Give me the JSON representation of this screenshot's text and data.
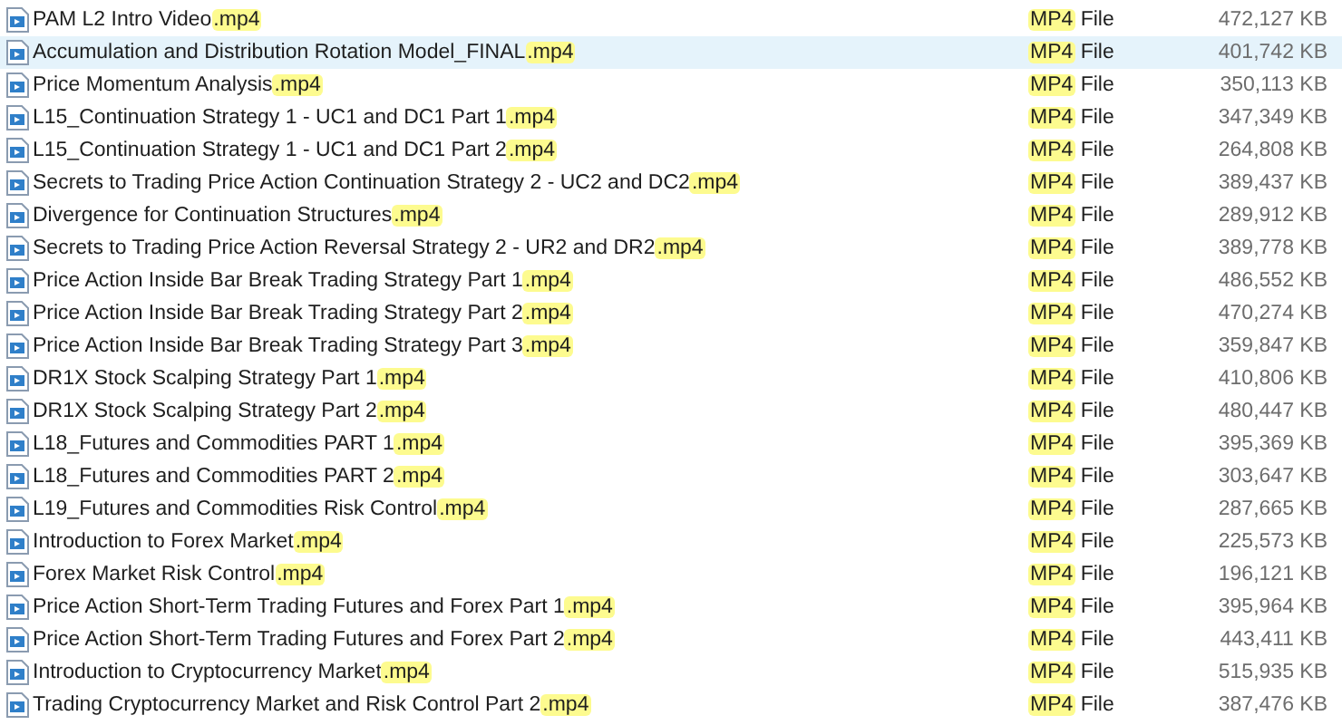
{
  "files": [
    {
      "name": [
        {
          "text": "PAM L2 Intro Video",
          "highlighted": false
        },
        {
          "text": ".mp4",
          "highlighted": true
        }
      ],
      "type": [
        {
          "text": "MP4",
          "highlighted": true
        },
        {
          "text": " File",
          "highlighted": false
        }
      ],
      "size": "472,127 KB",
      "selected": false
    },
    {
      "name": [
        {
          "text": "Accumulation and Distribution Rotation Model_FINAL",
          "highlighted": false
        },
        {
          "text": ".mp4",
          "highlighted": true
        }
      ],
      "type": [
        {
          "text": "MP4",
          "highlighted": true
        },
        {
          "text": " File",
          "highlighted": false
        }
      ],
      "size": "401,742 KB",
      "selected": true
    },
    {
      "name": [
        {
          "text": "Price Momentum Analysis",
          "highlighted": false
        },
        {
          "text": ".mp4",
          "highlighted": true
        }
      ],
      "type": [
        {
          "text": "MP4",
          "highlighted": true
        },
        {
          "text": " File",
          "highlighted": false
        }
      ],
      "size": "350,113 KB",
      "selected": false
    },
    {
      "name": [
        {
          "text": "L15_Continuation Strategy 1 - UC1 and DC1 Part 1",
          "highlighted": false
        },
        {
          "text": ".mp4",
          "highlighted": true
        }
      ],
      "type": [
        {
          "text": "MP4",
          "highlighted": true
        },
        {
          "text": " File",
          "highlighted": false
        }
      ],
      "size": "347,349 KB",
      "selected": false
    },
    {
      "name": [
        {
          "text": "L15_Continuation Strategy 1 - UC1 and DC1 Part 2",
          "highlighted": false
        },
        {
          "text": ".mp4",
          "highlighted": true
        }
      ],
      "type": [
        {
          "text": "MP4",
          "highlighted": true
        },
        {
          "text": " File",
          "highlighted": false
        }
      ],
      "size": "264,808 KB",
      "selected": false
    },
    {
      "name": [
        {
          "text": "Secrets to Trading Price Action Continuation Strategy 2 - UC2 and DC2",
          "highlighted": false
        },
        {
          "text": ".mp4",
          "highlighted": true
        }
      ],
      "type": [
        {
          "text": "MP4",
          "highlighted": true
        },
        {
          "text": " File",
          "highlighted": false
        }
      ],
      "size": "389,437 KB",
      "selected": false
    },
    {
      "name": [
        {
          "text": "Divergence for Continuation Structures",
          "highlighted": false
        },
        {
          "text": ".mp4",
          "highlighted": true
        }
      ],
      "type": [
        {
          "text": "MP4",
          "highlighted": true
        },
        {
          "text": " File",
          "highlighted": false
        }
      ],
      "size": "289,912 KB",
      "selected": false
    },
    {
      "name": [
        {
          "text": "Secrets to Trading Price Action Reversal Strategy 2 - UR2 and DR2",
          "highlighted": false
        },
        {
          "text": ".mp4",
          "highlighted": true
        }
      ],
      "type": [
        {
          "text": "MP4",
          "highlighted": true
        },
        {
          "text": " File",
          "highlighted": false
        }
      ],
      "size": "389,778 KB",
      "selected": false
    },
    {
      "name": [
        {
          "text": "Price Action Inside Bar Break Trading Strategy Part 1",
          "highlighted": false
        },
        {
          "text": ".mp4",
          "highlighted": true
        }
      ],
      "type": [
        {
          "text": "MP4",
          "highlighted": true
        },
        {
          "text": " File",
          "highlighted": false
        }
      ],
      "size": "486,552 KB",
      "selected": false
    },
    {
      "name": [
        {
          "text": "Price Action Inside Bar Break Trading Strategy Part 2",
          "highlighted": false
        },
        {
          "text": ".mp4",
          "highlighted": true
        }
      ],
      "type": [
        {
          "text": "MP4",
          "highlighted": true
        },
        {
          "text": " File",
          "highlighted": false
        }
      ],
      "size": "470,274 KB",
      "selected": false
    },
    {
      "name": [
        {
          "text": "Price Action Inside Bar Break Trading Strategy Part 3",
          "highlighted": false
        },
        {
          "text": ".mp4",
          "highlighted": true
        }
      ],
      "type": [
        {
          "text": "MP4",
          "highlighted": true
        },
        {
          "text": " File",
          "highlighted": false
        }
      ],
      "size": "359,847 KB",
      "selected": false
    },
    {
      "name": [
        {
          "text": "DR1X Stock Scalping Strategy Part 1",
          "highlighted": false
        },
        {
          "text": ".mp4",
          "highlighted": true
        }
      ],
      "type": [
        {
          "text": "MP4",
          "highlighted": true
        },
        {
          "text": " File",
          "highlighted": false
        }
      ],
      "size": "410,806 KB",
      "selected": false
    },
    {
      "name": [
        {
          "text": "DR1X Stock Scalping Strategy Part 2",
          "highlighted": false
        },
        {
          "text": ".mp4",
          "highlighted": true
        }
      ],
      "type": [
        {
          "text": "MP4",
          "highlighted": true
        },
        {
          "text": " File",
          "highlighted": false
        }
      ],
      "size": "480,447 KB",
      "selected": false
    },
    {
      "name": [
        {
          "text": "L18_Futures and Commodities PART 1",
          "highlighted": false
        },
        {
          "text": ".mp4",
          "highlighted": true
        }
      ],
      "type": [
        {
          "text": "MP4",
          "highlighted": true
        },
        {
          "text": " File",
          "highlighted": false
        }
      ],
      "size": "395,369 KB",
      "selected": false
    },
    {
      "name": [
        {
          "text": "L18_Futures and Commodities PART 2",
          "highlighted": false
        },
        {
          "text": ".mp4",
          "highlighted": true
        }
      ],
      "type": [
        {
          "text": "MP4",
          "highlighted": true
        },
        {
          "text": " File",
          "highlighted": false
        }
      ],
      "size": "303,647 KB",
      "selected": false
    },
    {
      "name": [
        {
          "text": "L19_Futures and Commodities Risk Control",
          "highlighted": false
        },
        {
          "text": ".mp4",
          "highlighted": true
        }
      ],
      "type": [
        {
          "text": "MP4",
          "highlighted": true
        },
        {
          "text": " File",
          "highlighted": false
        }
      ],
      "size": "287,665 KB",
      "selected": false
    },
    {
      "name": [
        {
          "text": "Introduction to Forex Market",
          "highlighted": false
        },
        {
          "text": ".mp4",
          "highlighted": true
        }
      ],
      "type": [
        {
          "text": "MP4",
          "highlighted": true
        },
        {
          "text": " File",
          "highlighted": false
        }
      ],
      "size": "225,573 KB",
      "selected": false
    },
    {
      "name": [
        {
          "text": "Forex Market Risk Control",
          "highlighted": false
        },
        {
          "text": ".mp4",
          "highlighted": true
        }
      ],
      "type": [
        {
          "text": "MP4",
          "highlighted": true
        },
        {
          "text": " File",
          "highlighted": false
        }
      ],
      "size": "196,121 KB",
      "selected": false
    },
    {
      "name": [
        {
          "text": "Price Action Short-Term Trading Futures and Forex Part 1",
          "highlighted": false
        },
        {
          "text": ".mp4",
          "highlighted": true
        }
      ],
      "type": [
        {
          "text": "MP4",
          "highlighted": true
        },
        {
          "text": " File",
          "highlighted": false
        }
      ],
      "size": "395,964 KB",
      "selected": false
    },
    {
      "name": [
        {
          "text": "Price Action Short-Term Trading Futures and Forex Part 2",
          "highlighted": false
        },
        {
          "text": ".mp4",
          "highlighted": true
        }
      ],
      "type": [
        {
          "text": "MP4",
          "highlighted": true
        },
        {
          "text": " File",
          "highlighted": false
        }
      ],
      "size": "443,411 KB",
      "selected": false
    },
    {
      "name": [
        {
          "text": "Introduction to Cryptocurrency Market",
          "highlighted": false
        },
        {
          "text": ".mp4",
          "highlighted": true
        }
      ],
      "type": [
        {
          "text": "MP4",
          "highlighted": true
        },
        {
          "text": " File",
          "highlighted": false
        }
      ],
      "size": "515,935 KB",
      "selected": false
    },
    {
      "name": [
        {
          "text": "Trading Cryptocurrency Market and Risk Control Part 2",
          "highlighted": false
        },
        {
          "text": ".mp4",
          "highlighted": true
        }
      ],
      "type": [
        {
          "text": "MP4",
          "highlighted": true
        },
        {
          "text": " File",
          "highlighted": false
        }
      ],
      "size": "387,476 KB",
      "selected": false
    }
  ]
}
